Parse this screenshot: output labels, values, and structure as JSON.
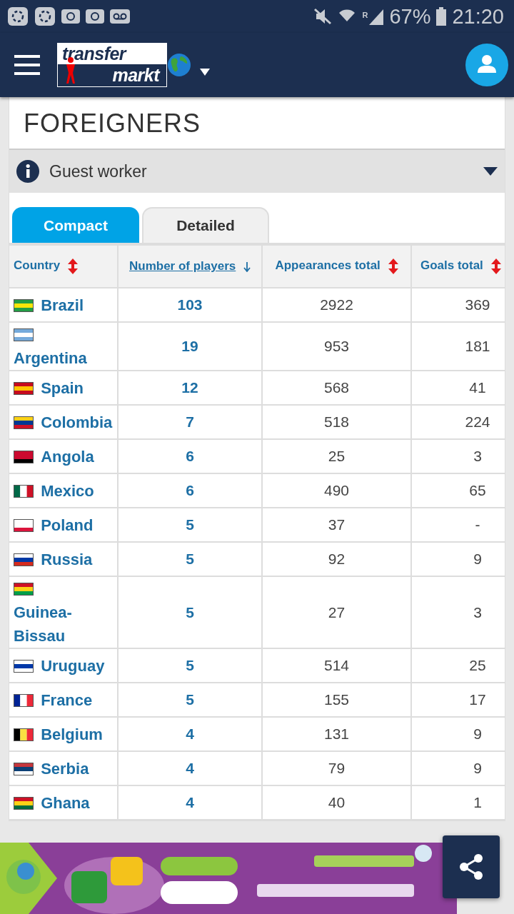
{
  "status_bar": {
    "network": "R",
    "battery": "67%",
    "time": "21:20"
  },
  "header": {
    "logo_top": "transfer",
    "logo_bottom": "markt"
  },
  "title": "FOREIGNERS",
  "info_bar": {
    "label": "Guest worker",
    "expanded": false
  },
  "tabs": [
    {
      "label": "Compact",
      "selected": true
    },
    {
      "label": "Detailed",
      "selected": false
    }
  ],
  "table": {
    "columns": [
      {
        "label": "Country",
        "sorted": false
      },
      {
        "label": "Number of players",
        "sorted": true
      },
      {
        "label": "Appearances total",
        "sorted": false
      },
      {
        "label": "Goals total",
        "sorted": false
      }
    ],
    "rows": [
      {
        "country": "Brazil",
        "players": "103",
        "appearances": "2922",
        "goals": "369"
      },
      {
        "country": "Argentina",
        "players": "19",
        "appearances": "953",
        "goals": "181"
      },
      {
        "country": "Spain",
        "players": "12",
        "appearances": "568",
        "goals": "41"
      },
      {
        "country": "Colombia",
        "players": "7",
        "appearances": "518",
        "goals": "224"
      },
      {
        "country": "Angola",
        "players": "6",
        "appearances": "25",
        "goals": "3"
      },
      {
        "country": "Mexico",
        "players": "6",
        "appearances": "490",
        "goals": "65"
      },
      {
        "country": "Poland",
        "players": "5",
        "appearances": "37",
        "goals": "-"
      },
      {
        "country": "Russia",
        "players": "5",
        "appearances": "92",
        "goals": "9"
      },
      {
        "country": "Guinea-Bissau",
        "players": "5",
        "appearances": "27",
        "goals": "3"
      },
      {
        "country": "Uruguay",
        "players": "5",
        "appearances": "514",
        "goals": "25"
      },
      {
        "country": "France",
        "players": "5",
        "appearances": "155",
        "goals": "17"
      },
      {
        "country": "Belgium",
        "players": "4",
        "appearances": "131",
        "goals": "9"
      },
      {
        "country": "Serbia",
        "players": "4",
        "appearances": "79",
        "goals": "9"
      },
      {
        "country": "Ghana",
        "players": "4",
        "appearances": "40",
        "goals": "1"
      }
    ]
  }
}
